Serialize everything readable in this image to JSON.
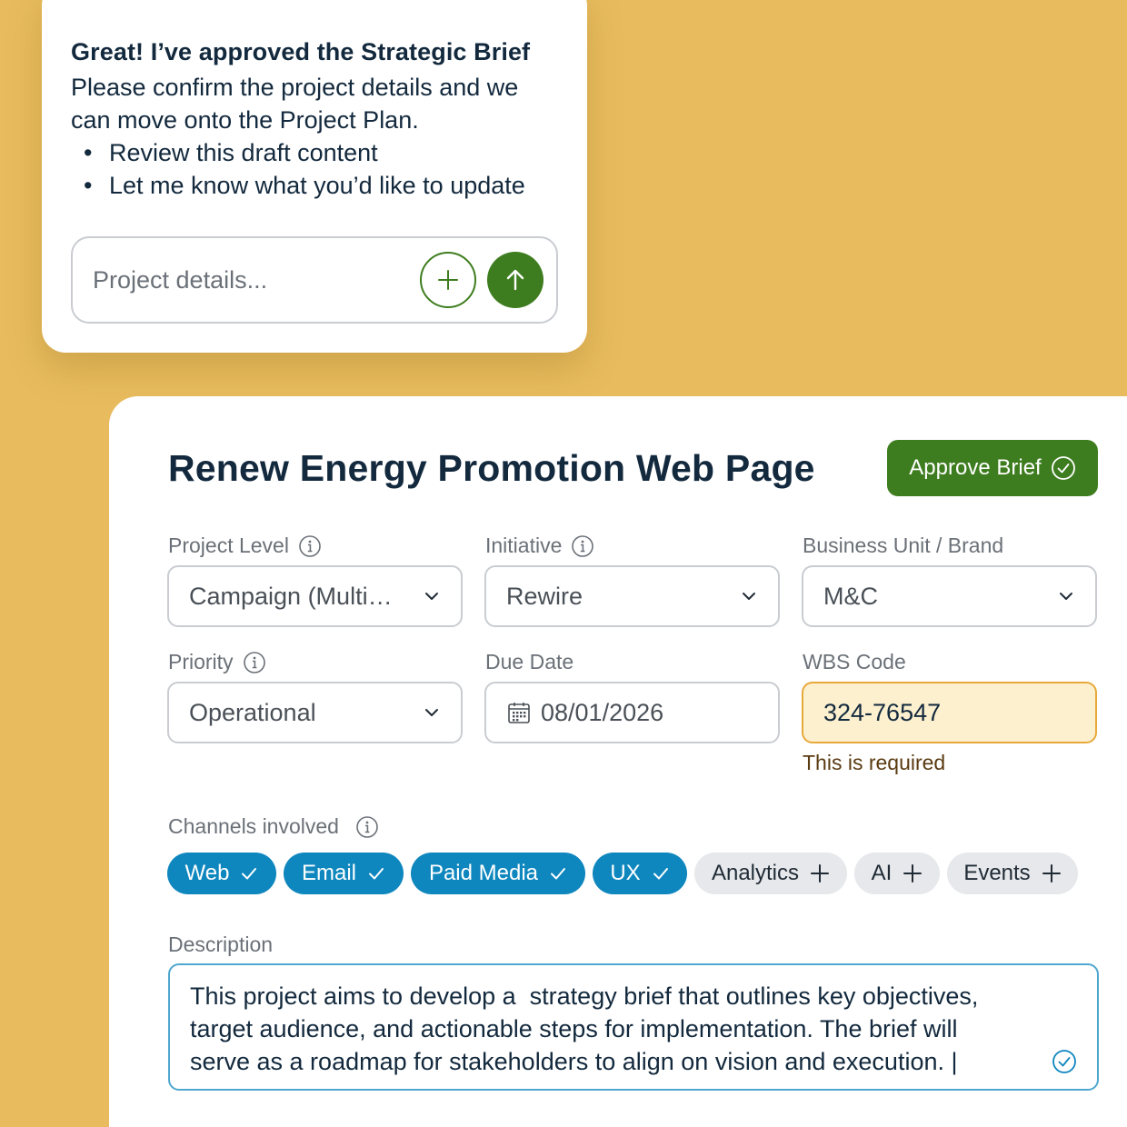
{
  "chat": {
    "title": "Great! I’ve approved the Strategic Brief",
    "message": "Please confirm the project details and we can move onto the Project Plan.",
    "bullets": [
      "Review this draft content",
      "Let me know what you’d like to update"
    ],
    "input_placeholder": "Project details...",
    "add_icon": "plus-icon",
    "send_icon": "arrow-up-icon"
  },
  "form": {
    "title": "Renew Energy Promotion Web Page",
    "approve_label": "Approve Brief",
    "fields": {
      "project_level": {
        "label": "Project Level",
        "value": "Campaign (Multi…"
      },
      "initiative": {
        "label": "Initiative",
        "value": "Rewire"
      },
      "business_unit": {
        "label": "Business Unit / Brand",
        "value": "M&C"
      },
      "priority": {
        "label": "Priority",
        "value": "Operational"
      },
      "due_date": {
        "label": "Due Date",
        "value": "08/01/2026"
      },
      "wbs_code": {
        "label": "WBS Code",
        "value": "324-76547",
        "error": "This is required"
      }
    },
    "channels": {
      "label": "Channels involved",
      "items": [
        {
          "label": "Web",
          "selected": true
        },
        {
          "label": "Email",
          "selected": true
        },
        {
          "label": "Paid Media",
          "selected": true
        },
        {
          "label": "UX",
          "selected": true
        },
        {
          "label": "Analytics",
          "selected": false
        },
        {
          "label": "AI",
          "selected": false
        },
        {
          "label": "Events",
          "selected": false
        }
      ]
    },
    "description": {
      "label": "Description",
      "value": "This project aims to develop a  strategy brief that outlines key objectives,\ntarget audience, and actionable steps for implementation. The brief will\nserve as a roadmap for stakeholders to align on vision and execution. |"
    }
  },
  "colors": {
    "background": "#E8BC5E",
    "primary_green": "#3E7D1F",
    "chip_selected": "#0E86BE",
    "chip_unselected": "#E6E8EB",
    "warning_fill": "#FDF0CF",
    "warning_border": "#E7A93B"
  }
}
